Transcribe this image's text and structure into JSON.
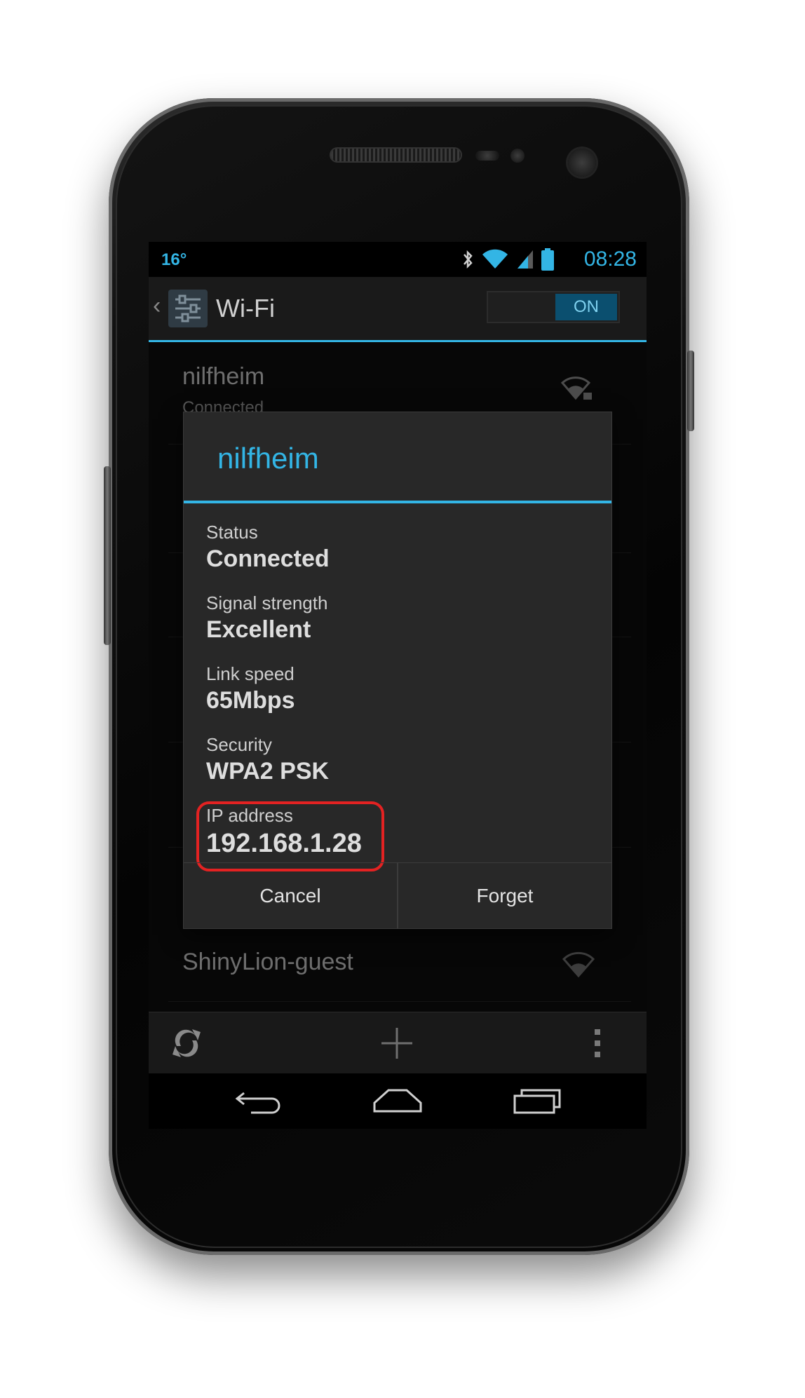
{
  "status_bar": {
    "temperature": "16°",
    "time": "08:28",
    "icons": [
      "bluetooth-icon",
      "wifi-icon",
      "cell-signal-icon",
      "battery-icon"
    ]
  },
  "action_bar": {
    "title": "Wi-Fi",
    "toggle_label": "ON"
  },
  "networks": [
    {
      "name": "nilfheim",
      "status": "Connected"
    },
    {
      "name": "ShinyLion-guest",
      "status": ""
    }
  ],
  "dialog": {
    "title": "nilfheim",
    "fields": [
      {
        "label": "Status",
        "value": "Connected"
      },
      {
        "label": "Signal strength",
        "value": "Excellent"
      },
      {
        "label": "Link speed",
        "value": "65Mbps"
      },
      {
        "label": "Security",
        "value": "WPA2 PSK"
      },
      {
        "label": "IP address",
        "value": "192.168.1.28"
      }
    ],
    "buttons": {
      "cancel": "Cancel",
      "forget": "Forget"
    }
  },
  "colors": {
    "accent": "#33b5e5",
    "highlight_outline": "#e32222"
  }
}
